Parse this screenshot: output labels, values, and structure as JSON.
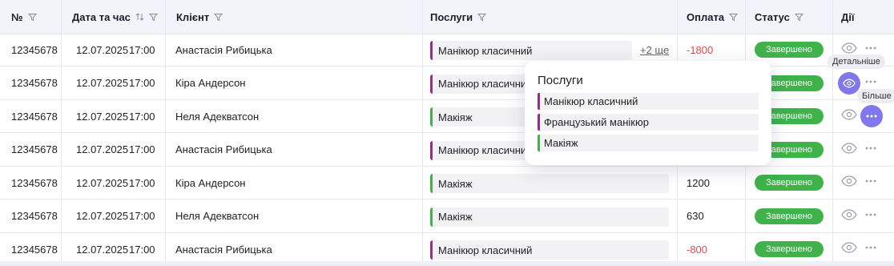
{
  "columns": {
    "number": "№",
    "datetime": "Дата та час",
    "client": "Клієнт",
    "services": "Послуги",
    "payment": "Оплата",
    "status": "Статус",
    "actions": "Дії"
  },
  "rows": [
    {
      "number": "12345678",
      "date": "12.07.2025",
      "time": "17:00",
      "client": "Анастасія Рибицька",
      "service": "Манікюр класичний",
      "service_color": "purple",
      "more": "+2 ще",
      "payment": "-1800",
      "status": "Завершено"
    },
    {
      "number": "12345678",
      "date": "12.07.2025",
      "time": "17:00",
      "client": "Кіра Андерсон",
      "service": "Манікюр класичний",
      "service_color": "purple",
      "more": "",
      "payment": "",
      "status": "Завершено"
    },
    {
      "number": "12345678",
      "date": "12.07.2025",
      "time": "17:00",
      "client": "Неля Адекватсон",
      "service": "Макіяж",
      "service_color": "green",
      "more": "",
      "payment": "",
      "status": "Завершено"
    },
    {
      "number": "12345678",
      "date": "12.07.2025",
      "time": "17:00",
      "client": "Анастасія Рибицька",
      "service": "Манікюр класичний",
      "service_color": "purple",
      "more": "",
      "payment": "",
      "status": "Завершено"
    },
    {
      "number": "12345678",
      "date": "12.07.2025",
      "time": "17:00",
      "client": "Кіра Андерсон",
      "service": "Макіяж",
      "service_color": "green",
      "more": "",
      "payment": "1200",
      "status": "Завершено"
    },
    {
      "number": "12345678",
      "date": "12.07.2025",
      "time": "17:00",
      "client": "Неля Адекватсон",
      "service": "Макіяж",
      "service_color": "green",
      "more": "",
      "payment": "630",
      "status": "Завершено"
    },
    {
      "number": "12345678",
      "date": "12.07.2025",
      "time": "17:00",
      "client": "Анастасія Рибицька",
      "service": "Манікюр класичний",
      "service_color": "purple",
      "more": "",
      "payment": "-800",
      "status": "Завершено"
    }
  ],
  "popover": {
    "title": "Послуги",
    "items": [
      {
        "label": "Манікюр класичний",
        "color": "purple"
      },
      {
        "label": "Французький манікюр",
        "color": "purple"
      },
      {
        "label": "Макіяж",
        "color": "green"
      }
    ]
  },
  "tooltips": {
    "details": "Детальніше",
    "more": "Більше"
  },
  "colors": {
    "accent": "#7f77ea",
    "status_green": "#3fb24a",
    "negative": "#e5484d",
    "service_purple": "#9b2a8f",
    "service_green": "#42b14a"
  },
  "icons": {
    "filter": "filter-icon",
    "sort": "sort-icon",
    "view": "eye-icon",
    "more": "more-dots-icon"
  }
}
